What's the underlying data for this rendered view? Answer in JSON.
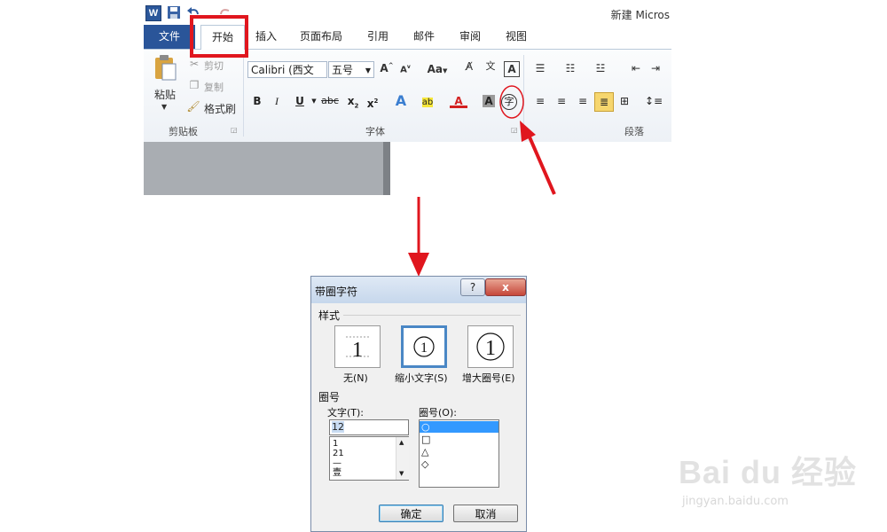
{
  "word": {
    "title": "新建 Micros",
    "logo_letter": "W",
    "tabs": [
      "文件",
      "开始",
      "插入",
      "页面布局",
      "引用",
      "邮件",
      "审阅",
      "视图"
    ],
    "clipboard": {
      "paste": "粘贴",
      "cut": "剪切",
      "copy": "复制",
      "format_painter": "格式刷",
      "group_label": "剪贴板"
    },
    "font": {
      "name": "Calibri (西文",
      "size": "五号",
      "group_label": "字体",
      "enclose_glyph": "字",
      "change_case": "Aa"
    },
    "paragraph": {
      "group_label": "段落"
    }
  },
  "dialog": {
    "title": "带圈字符",
    "help": "?",
    "close": "x",
    "style_section": "样式",
    "styles": [
      {
        "label": "无(N)",
        "glyph": "1"
      },
      {
        "label": "缩小文字(S)",
        "glyph": "①"
      },
      {
        "label": "增大圈号(E)",
        "glyph": "①"
      }
    ],
    "enclosure_section": "圈号",
    "text_label": "文字(T):",
    "text_value": "12",
    "text_options": [
      "1",
      "21",
      "—",
      "壹"
    ],
    "enclosure_label": "圈号(O):",
    "enclosure_options": [
      "○",
      "□",
      "△",
      "◇"
    ],
    "ok": "确定",
    "cancel": "取消"
  },
  "watermark": {
    "brand": "Bai du 经验",
    "url": "jingyan.baidu.com"
  },
  "colors": {
    "highlight_red": "#e0161e",
    "file_tab": "#2a5599",
    "selection_blue": "#3399ff"
  }
}
